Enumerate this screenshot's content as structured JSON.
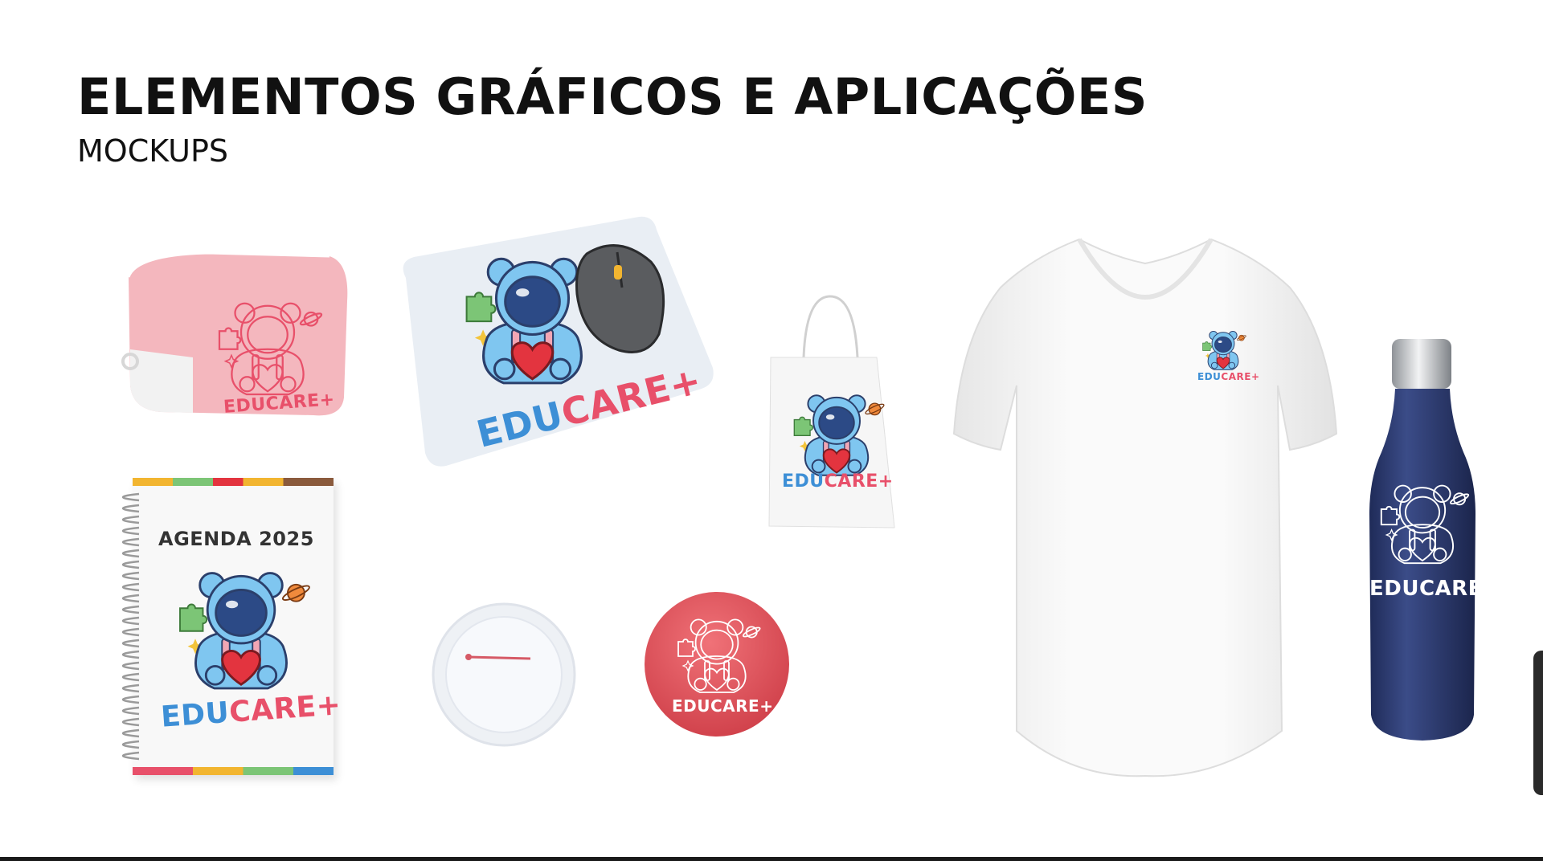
{
  "slide": {
    "title": "ELEMENTOS GRÁFICOS E APLICAÇÕES",
    "subtitle": "MOCKUPS"
  },
  "brand": {
    "edu": "EDU",
    "care": "CARE",
    "plus": "+",
    "mono_name": "EDUCARE+",
    "mono_name_bottle": "EDUCARE"
  },
  "agenda": {
    "title": "AGENDA 2025"
  },
  "icons": [
    "bear-astronaut-logo-icon",
    "heart-icon",
    "puzzle-icon",
    "planet-icon"
  ],
  "colors": {
    "brand_blue": "#3d8fd6",
    "brand_pink": "#e8506a",
    "pouch_pink": "#f4b7be",
    "badge_red": "#e4535d",
    "bottle_navy": "#2c3b73"
  }
}
